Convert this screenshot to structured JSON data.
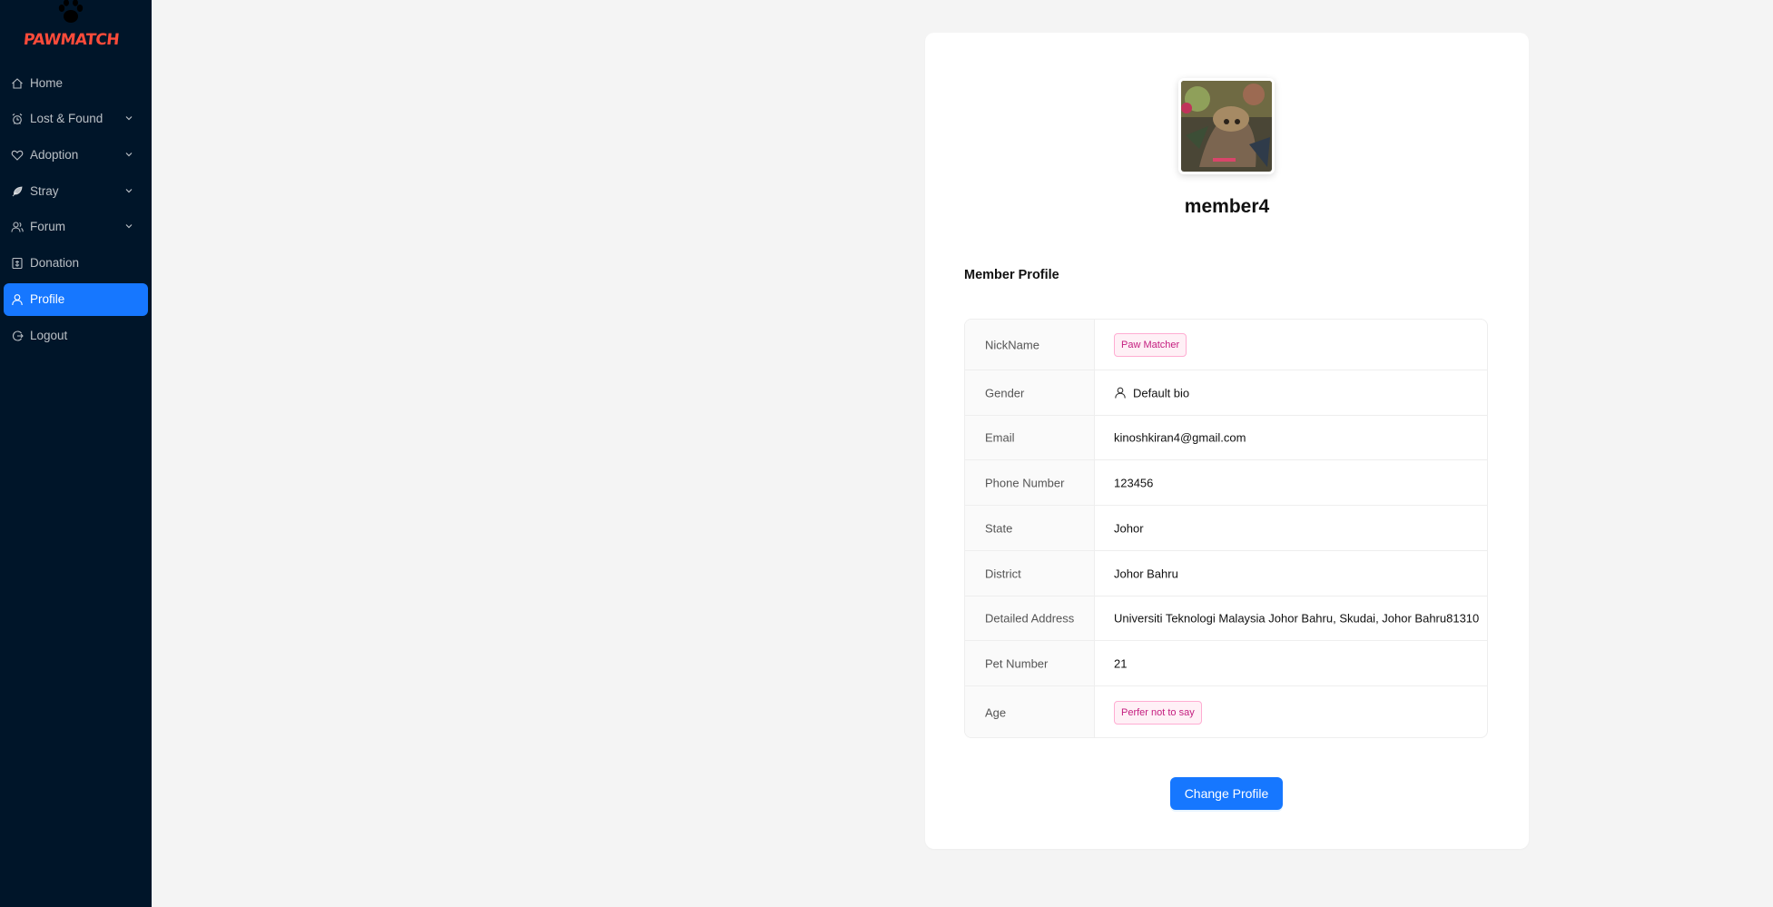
{
  "app": {
    "logo_text": "PAWMATCH",
    "brand_color": "#ff4b3a",
    "sidebar_bg": "#001529",
    "accent": "#1677ff"
  },
  "sidebar": {
    "items": [
      {
        "label": "Home",
        "icon": "home-icon",
        "has_submenu": false,
        "active": false
      },
      {
        "label": "Lost & Found",
        "icon": "alarm-icon",
        "has_submenu": true,
        "active": false
      },
      {
        "label": "Adoption",
        "icon": "heart-icon",
        "has_submenu": true,
        "active": false
      },
      {
        "label": "Stray",
        "icon": "feather-icon",
        "has_submenu": true,
        "active": false
      },
      {
        "label": "Forum",
        "icon": "team-icon",
        "has_submenu": true,
        "active": false
      },
      {
        "label": "Donation",
        "icon": "donation-box-icon",
        "has_submenu": false,
        "active": false
      },
      {
        "label": "Profile",
        "icon": "user-icon",
        "has_submenu": false,
        "active": true
      },
      {
        "label": "Logout",
        "icon": "logout-icon",
        "has_submenu": false,
        "active": false
      }
    ]
  },
  "profile": {
    "username": "member4",
    "section_title": "Member Profile",
    "fields": {
      "nickname": {
        "label": "NickName",
        "value": "Paw Matcher"
      },
      "gender": {
        "label": "Gender",
        "value": "Default bio"
      },
      "email": {
        "label": "Email",
        "value": "kinoshkiran4@gmail.com"
      },
      "phone": {
        "label": "Phone Number",
        "value": "123456"
      },
      "state": {
        "label": "State",
        "value": "Johor"
      },
      "district": {
        "label": "District",
        "value": "Johor Bahru"
      },
      "address": {
        "label": "Detailed Address",
        "value": "Universiti Teknologi Malaysia Johor Bahru, Skudai, Johor Bahru81310"
      },
      "pet_number": {
        "label": "Pet Number",
        "value": "21"
      },
      "age": {
        "label": "Age",
        "value": "Perfer not to say"
      }
    },
    "change_button": "Change Profile"
  }
}
